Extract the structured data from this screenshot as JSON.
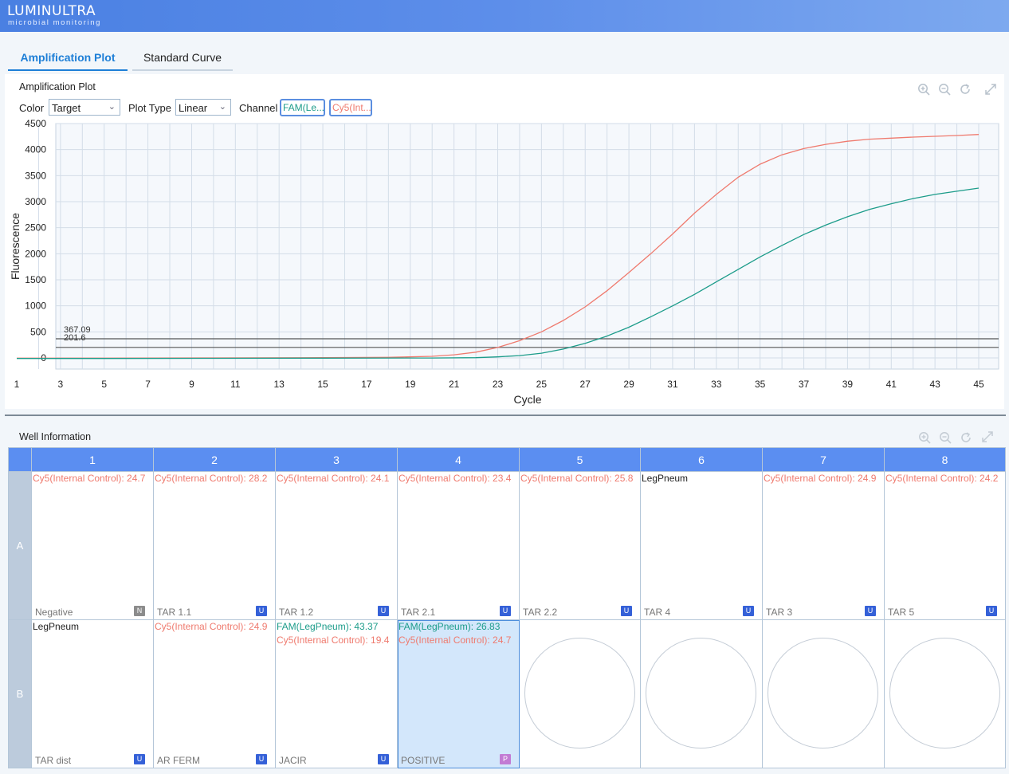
{
  "app": {
    "logo": "LUMINULTRA",
    "logo_sub": "microbial monitoring"
  },
  "tabs": [
    {
      "label": "Amplification Plot",
      "active": true
    },
    {
      "label": "Standard Curve",
      "active": false
    }
  ],
  "plot_panel": {
    "title": "Amplification Plot",
    "controls": {
      "color_label": "Color",
      "color_value": "Target",
      "plot_type_label": "Plot Type",
      "plot_type_value": "Linear",
      "channel_label": "Channel",
      "channels": [
        {
          "label": "FAM(Le...",
          "color": "#1c9c8a"
        },
        {
          "label": "Cy5(Int...",
          "color": "#ef7a6e"
        }
      ]
    },
    "toolbar_icons": [
      "zoom-in-icon",
      "zoom-out-icon",
      "refresh-icon",
      "expand-icon"
    ]
  },
  "chart_data": {
    "type": "line",
    "xlabel": "Cycle",
    "ylabel": "Fluorescence",
    "xlim": [
      1,
      46
    ],
    "ylim": [
      -20,
      4500
    ],
    "x_ticks": [
      1,
      3,
      5,
      7,
      9,
      11,
      13,
      15,
      17,
      19,
      21,
      23,
      25,
      27,
      29,
      31,
      33,
      35,
      37,
      39,
      41,
      43,
      45
    ],
    "y_ticks": [
      0,
      500,
      1000,
      1500,
      2000,
      2500,
      3000,
      3500,
      4000,
      4500
    ],
    "grid": true,
    "thresholds": [
      {
        "value": 367.09,
        "label": "367.09"
      },
      {
        "value": 201.6,
        "label": "201.6"
      }
    ],
    "series": [
      {
        "color": "#ef7a6e",
        "x": [
          1,
          5,
          10,
          15,
          18,
          20,
          21,
          22,
          23,
          24,
          25,
          26,
          27,
          28,
          29,
          30,
          31,
          32,
          33,
          34,
          35,
          36,
          37,
          38,
          39,
          40,
          41,
          42,
          43,
          44,
          45
        ],
        "y": [
          -5,
          -5,
          0,
          5,
          10,
          30,
          60,
          110,
          200,
          330,
          500,
          720,
          980,
          1290,
          1640,
          2000,
          2380,
          2780,
          3140,
          3470,
          3720,
          3900,
          4020,
          4100,
          4160,
          4200,
          4220,
          4240,
          4255,
          4270,
          4290
        ]
      },
      {
        "color": "#1c9c8a",
        "x": [
          1,
          5,
          10,
          15,
          20,
          22,
          23,
          24,
          25,
          26,
          27,
          28,
          29,
          30,
          31,
          32,
          33,
          34,
          35,
          36,
          37,
          38,
          39,
          40,
          41,
          42,
          43,
          44,
          45
        ],
        "y": [
          -10,
          -10,
          -8,
          -5,
          -2,
          5,
          20,
          45,
          90,
          170,
          280,
          420,
          590,
          790,
          1000,
          1220,
          1460,
          1700,
          1940,
          2160,
          2370,
          2550,
          2710,
          2850,
          2960,
          3060,
          3140,
          3200,
          3260
        ]
      }
    ]
  },
  "well_panel": {
    "title": "Well Information",
    "toolbar_icons": [
      "zoom-in-icon",
      "zoom-out-icon",
      "refresh-icon",
      "expand-icon"
    ],
    "columns": [
      "1",
      "2",
      "3",
      "4",
      "5",
      "6",
      "7",
      "8"
    ],
    "rows": [
      {
        "label": "A",
        "wells": [
          {
            "lines": [
              {
                "text": "Cy5(Internal Control): 24.7",
                "color": "red"
              }
            ],
            "name": "Negative",
            "badge": "N"
          },
          {
            "lines": [
              {
                "text": "Cy5(Internal Control): 28.2",
                "color": "red"
              }
            ],
            "name": "TAR 1.1",
            "badge": "U"
          },
          {
            "lines": [
              {
                "text": "Cy5(Internal Control): 24.1",
                "color": "red"
              }
            ],
            "name": "TAR 1.2",
            "badge": "U"
          },
          {
            "lines": [
              {
                "text": "Cy5(Internal Control): 23.4",
                "color": "red"
              }
            ],
            "name": "TAR 2.1",
            "badge": "U"
          },
          {
            "lines": [
              {
                "text": "Cy5(Internal Control): 25.8",
                "color": "red"
              }
            ],
            "name": "TAR 2.2",
            "badge": "U"
          },
          {
            "lines": [
              {
                "text": "LegPneum",
                "color": "dark"
              }
            ],
            "name": "TAR 4",
            "badge": "U"
          },
          {
            "lines": [
              {
                "text": "Cy5(Internal Control): 24.9",
                "color": "red"
              }
            ],
            "name": "TAR 3",
            "badge": "U"
          },
          {
            "lines": [
              {
                "text": "Cy5(Internal Control): 24.2",
                "color": "red"
              }
            ],
            "name": "TAR 5",
            "badge": "U"
          }
        ]
      },
      {
        "label": "B",
        "wells": [
          {
            "lines": [
              {
                "text": "LegPneum",
                "color": "dark"
              }
            ],
            "name": "TAR dist",
            "badge": "U"
          },
          {
            "lines": [
              {
                "text": "Cy5(Internal Control): 24.9",
                "color": "red"
              }
            ],
            "name": "AR FERM",
            "badge": "U"
          },
          {
            "lines": [
              {
                "text": "FAM(LegPneum): 43.37",
                "color": "teal"
              },
              {
                "text": "Cy5(Internal Control): 19.4",
                "color": "red"
              }
            ],
            "name": "JACIR",
            "badge": "U"
          },
          {
            "lines": [
              {
                "text": "FAM(LegPneum): 26.83",
                "color": "teal"
              },
              {
                "text": "Cy5(Internal Control): 24.7",
                "color": "red"
              }
            ],
            "name": "POSITIVE",
            "badge": "P",
            "selected": true
          },
          {
            "empty": true
          },
          {
            "empty": true
          },
          {
            "empty": true
          },
          {
            "empty": true
          }
        ]
      }
    ]
  }
}
